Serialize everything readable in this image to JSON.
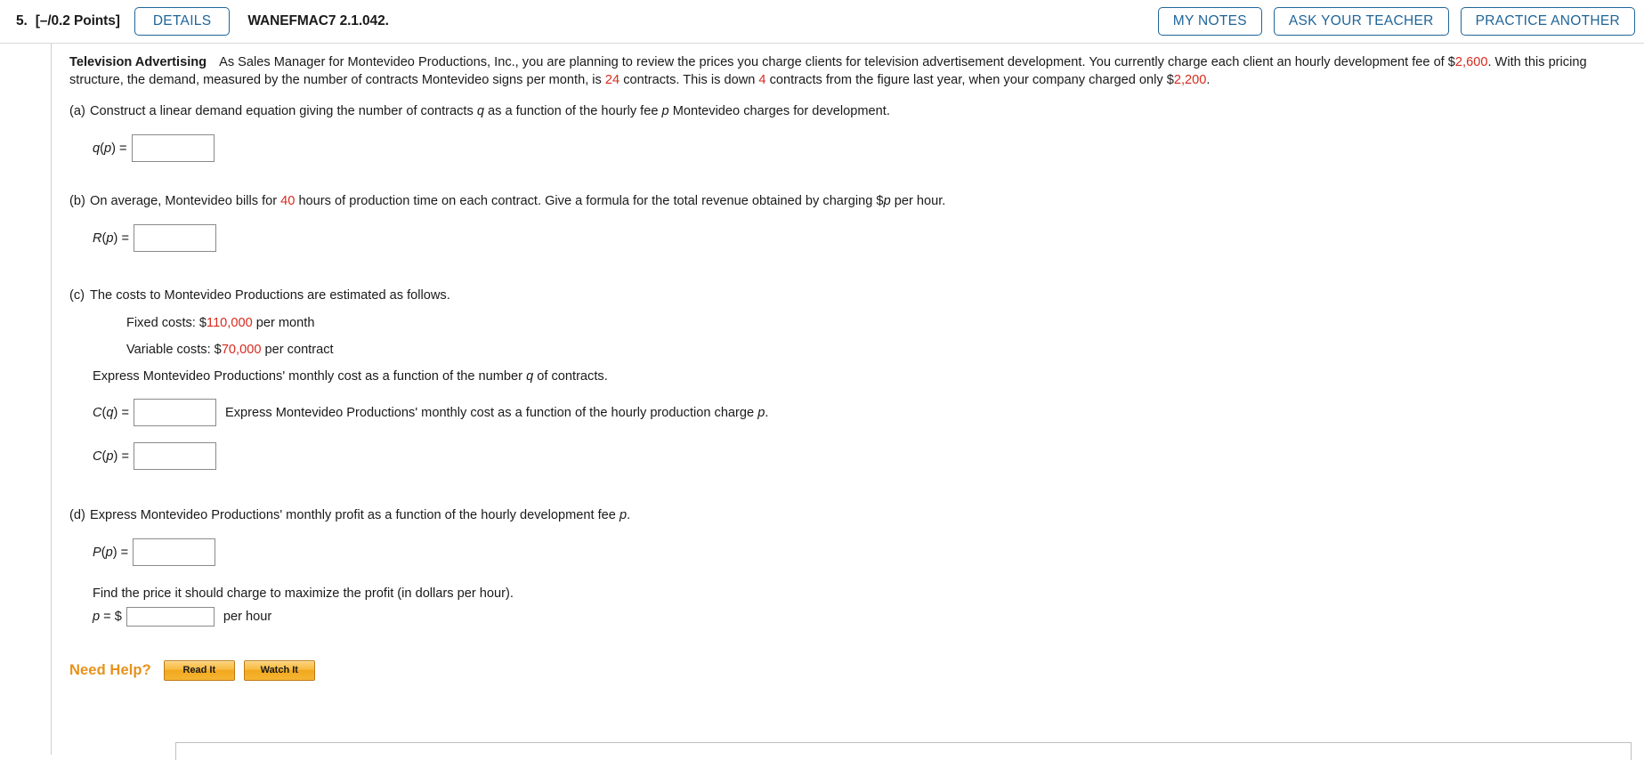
{
  "header": {
    "question_number": "5.",
    "points": "[–/0.2 Points]",
    "details_label": "DETAILS",
    "assignment_code": "WANEFMAC7 2.1.042.",
    "my_notes_label": "MY NOTES",
    "ask_teacher_label": "ASK YOUR TEACHER",
    "practice_another_label": "PRACTICE ANOTHER",
    "accent_color": "#1f6599"
  },
  "problem": {
    "title": "Television Advertising",
    "intro_1": "As Sales Manager for Montevideo Productions, Inc., you are planning to review the prices you charge clients for television advertisement development. You currently charge each client an hourly development fee of $",
    "hourly_fee": "2,600",
    "intro_2": ". With this pricing structure, the demand, measured by the number of contracts Montevideo signs per month, is ",
    "contracts": "24",
    "intro_3": " contracts. This is down ",
    "down_contracts": "4",
    "intro_4": " contracts from the figure last year, when your company charged only $",
    "last_year_fee": "2,200",
    "intro_5": ".",
    "highlight_color": "#d62b1f"
  },
  "parts": {
    "a": {
      "label": "(a)",
      "text_1": "Construct a linear demand equation giving the number of contracts ",
      "var_q": "q",
      "text_2": " as a function of the hourly fee ",
      "var_p": "p",
      "text_3": " Montevideo charges for development.",
      "answer_label_fn": "q",
      "answer_label_arg": "p",
      "answer_value": "",
      "answer_placeholder": ""
    },
    "b": {
      "label": "(b)",
      "text_1": "On average, Montevideo bills for ",
      "hours": "40",
      "text_2": " hours of production time on each contract. Give a formula for the total revenue obtained by charging $",
      "var_p": "p",
      "text_3": " per hour.",
      "answer_label_fn": "R",
      "answer_label_arg": "p",
      "answer_value": "",
      "answer_placeholder": ""
    },
    "c": {
      "label": "(c)",
      "text": "The costs to Montevideo Productions are estimated as follows.",
      "fixed_costs_label": "Fixed costs: $",
      "fixed_costs_value": "110,000",
      "fixed_costs_suffix": " per month",
      "variable_costs_label": "Variable costs: $",
      "variable_costs_value": "70,000",
      "variable_costs_suffix": " per contract",
      "express_q_text_1": "Express Montevideo Productions' monthly cost as a function of the number ",
      "express_q_var": "q",
      "express_q_text_2": " of contracts.",
      "answer_cq_fn": "C",
      "answer_cq_arg": "q",
      "answer_cq_value": "",
      "after_cq_text_1": "Express Montevideo Productions' monthly cost as a function of the hourly production charge ",
      "after_cq_var": "p",
      "after_cq_text_2": ".",
      "answer_cp_fn": "C",
      "answer_cp_arg": "p",
      "answer_cp_value": ""
    },
    "d": {
      "label": "(d)",
      "text_1": "Express Montevideo Productions' monthly profit as a function of the hourly development fee ",
      "var_p": "p",
      "text_2": ".",
      "answer_label_fn": "P",
      "answer_label_arg": "p",
      "answer_value": "",
      "maximize_text": "Find the price it should charge to maximize the profit (in dollars per hour).",
      "price_prefix_var": "p",
      "price_prefix_eq": " = $",
      "price_value": "",
      "price_suffix": "per hour"
    }
  },
  "need_help": {
    "label": "Need Help?",
    "read_it_label": "Read It",
    "watch_it_label": "Watch It",
    "label_color": "#e8911a"
  }
}
